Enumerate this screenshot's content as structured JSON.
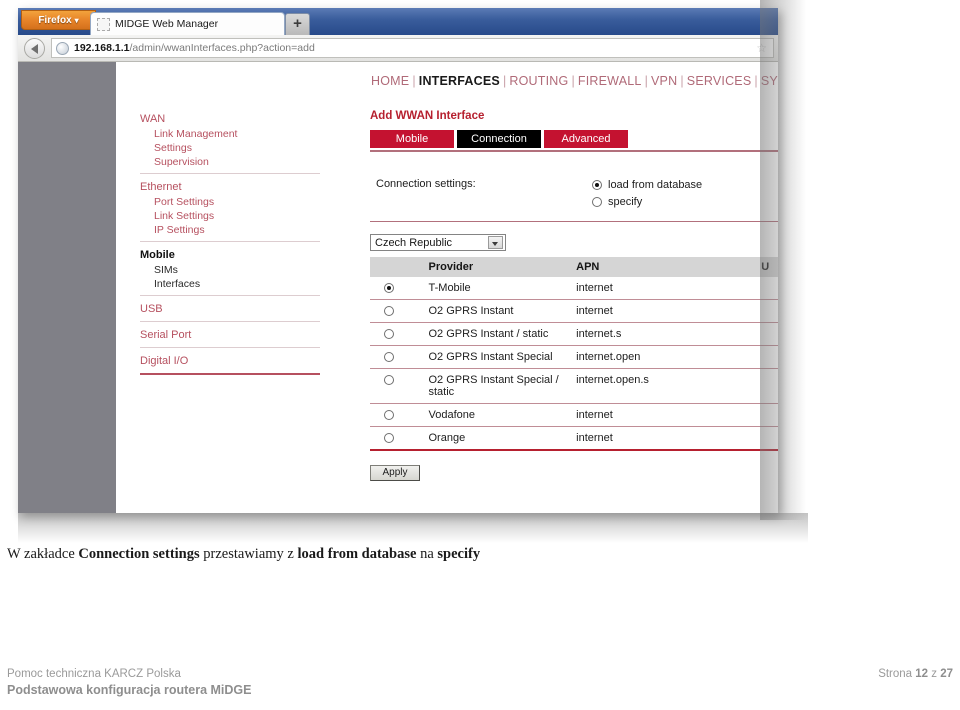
{
  "browser": {
    "firefox_button": "Firefox",
    "firefox_caret": "▾",
    "tab_title": "MIDGE Web Manager",
    "new_tab_label": "+",
    "url_host": "192.168.1.1",
    "url_path": "/admin/wwanInterfaces.php?action=add",
    "bookmark_star": "☆"
  },
  "topnav": {
    "items": [
      {
        "label": "HOME",
        "active": false
      },
      {
        "label": "INTERFACES",
        "active": true
      },
      {
        "label": "ROUTING",
        "active": false
      },
      {
        "label": "FIREWALL",
        "active": false
      },
      {
        "label": "VPN",
        "active": false
      },
      {
        "label": "SERVICES",
        "active": false
      },
      {
        "label": "SY",
        "active": false
      }
    ],
    "separator": "|"
  },
  "sidebar": {
    "groups": [
      {
        "head": "WAN",
        "active": false,
        "items": [
          "Link Management",
          "Settings",
          "Supervision"
        ]
      },
      {
        "head": "Ethernet",
        "active": false,
        "items": [
          "Port Settings",
          "Link Settings",
          "IP Settings"
        ]
      },
      {
        "head": "Mobile",
        "active": true,
        "items": [
          "SIMs",
          "Interfaces"
        ]
      },
      {
        "head": "USB",
        "active": false,
        "items": []
      },
      {
        "head": "Serial Port",
        "active": false,
        "items": []
      },
      {
        "head": "Digital I/O",
        "active": false,
        "items": []
      }
    ]
  },
  "main": {
    "title": "Add WWAN Interface",
    "tabs": [
      {
        "label": "Mobile",
        "active": false
      },
      {
        "label": "Connection",
        "active": true
      },
      {
        "label": "Advanced",
        "active": false
      }
    ],
    "connection_settings_label": "Connection settings:",
    "connection_options": [
      {
        "label": "load from database",
        "selected": true
      },
      {
        "label": "specify",
        "selected": false
      }
    ],
    "country_select": {
      "value": "Czech Republic",
      "options": [
        "Czech Republic"
      ]
    },
    "table": {
      "headers": [
        "",
        "Provider",
        "APN",
        "U"
      ],
      "rows": [
        {
          "selected": true,
          "provider": "T-Mobile",
          "apn": "internet"
        },
        {
          "selected": false,
          "provider": "O2 GPRS Instant",
          "apn": "internet"
        },
        {
          "selected": false,
          "provider": "O2 GPRS Instant / static",
          "apn": "internet.s"
        },
        {
          "selected": false,
          "provider": "O2 GPRS Instant Special",
          "apn": "internet.open"
        },
        {
          "selected": false,
          "provider": "O2 GPRS Instant Special / static",
          "apn": "internet.open.s"
        },
        {
          "selected": false,
          "provider": "Vodafone",
          "apn": "internet"
        },
        {
          "selected": false,
          "provider": "Orange",
          "apn": "internet"
        }
      ]
    },
    "apply_label": "Apply"
  },
  "caption": {
    "part1": "W zakładce ",
    "bold1": "Connection settings",
    "part2": " przestawiamy z ",
    "bold2": "load from database",
    "part3": " na ",
    "bold3": "specify"
  },
  "footer": {
    "left_line1": "Pomoc techniczna KARCZ Polska",
    "left_line2": "Podstawowa konfiguracja routera MiDGE",
    "page_prefix": "Strona ",
    "page_number": "12",
    "page_middle": " z ",
    "page_total": "27"
  },
  "colors": {
    "brand_red": "#c41230",
    "title_red": "#b6202f",
    "menu_red": "#b6505f",
    "nav_pink": "#b06a78",
    "tab_active_black": "#000000",
    "gutter_grey": "#808087",
    "table_header_grey": "#d5d5d5",
    "footer_grey": "#9a9a9a"
  }
}
